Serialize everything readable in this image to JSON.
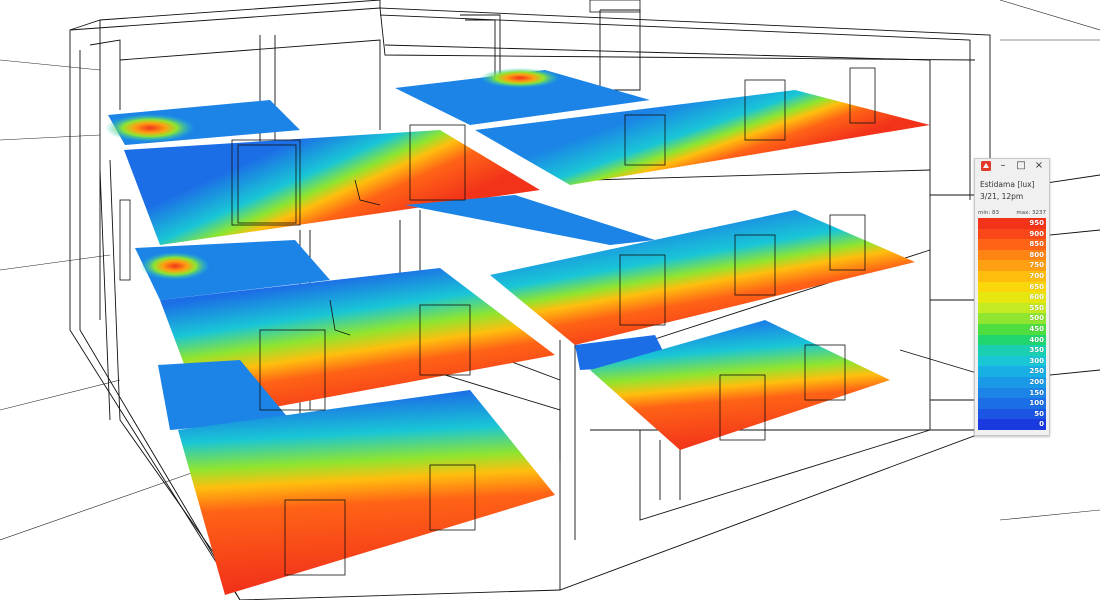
{
  "viewport": {
    "name": "3D daylight simulation viewport"
  },
  "legend_window": {
    "title": "Estidama [lux]",
    "date": "3/21, 12pm",
    "min_label": "min: 83",
    "max_label": "max: 3237",
    "buttons": {
      "minimize": "–",
      "restore": "□",
      "close": "×"
    },
    "scale": [
      {
        "label": "950",
        "color": "#f2331a"
      },
      {
        "label": "900",
        "color": "#fa4719"
      },
      {
        "label": "850",
        "color": "#ff6316"
      },
      {
        "label": "800",
        "color": "#ff8414"
      },
      {
        "label": "750",
        "color": "#ffa012"
      },
      {
        "label": "700",
        "color": "#ffbe0e"
      },
      {
        "label": "650",
        "color": "#f9d70a"
      },
      {
        "label": "600",
        "color": "#e6e70f"
      },
      {
        "label": "550",
        "color": "#c4ea21"
      },
      {
        "label": "500",
        "color": "#8fe52f"
      },
      {
        "label": "450",
        "color": "#4fde3f"
      },
      {
        "label": "400",
        "color": "#21d66e"
      },
      {
        "label": "350",
        "color": "#1bd0b0"
      },
      {
        "label": "300",
        "color": "#19c6d6"
      },
      {
        "label": "250",
        "color": "#18b0e4"
      },
      {
        "label": "200",
        "color": "#1a9ae6"
      },
      {
        "label": "150",
        "color": "#1b84e6"
      },
      {
        "label": "100",
        "color": "#1c6ee6"
      },
      {
        "label": "50",
        "color": "#1c55e3"
      },
      {
        "label": "0",
        "color": "#1a3ae0"
      }
    ]
  }
}
